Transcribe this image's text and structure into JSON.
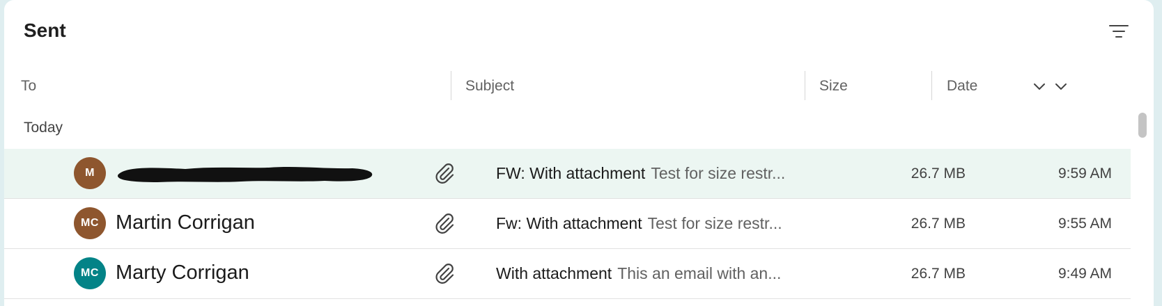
{
  "folder": {
    "title": "Sent"
  },
  "toolbar": {
    "filter_icon": "filter-icon"
  },
  "columns": {
    "to": "To",
    "subject": "Subject",
    "size": "Size",
    "date": "Date"
  },
  "groups": [
    {
      "label": "Today"
    }
  ],
  "messages": [
    {
      "initials": "M",
      "avatar_color": "#8e562e",
      "sender": "",
      "sender_redacted": true,
      "has_attachment": true,
      "subject": "FW: With attachment",
      "preview": "Test for size restr...",
      "size": "26.7 MB",
      "date": "9:59 AM",
      "selected": true
    },
    {
      "initials": "MC",
      "avatar_color": "#8e562e",
      "sender": "Martin Corrigan",
      "has_attachment": true,
      "subject": "Fw: With attachment",
      "preview": "Test for size restr...",
      "size": "26.7 MB",
      "date": "9:55 AM",
      "selected": false
    },
    {
      "initials": "MC",
      "avatar_color": "#038387",
      "sender": "Marty Corrigan",
      "has_attachment": true,
      "subject": "With attachment",
      "preview": "This an email with an...",
      "size": "26.7 MB",
      "date": "9:49 AM",
      "selected": false
    }
  ],
  "colors": {
    "selected_row": "#ecf6f2",
    "background": "#dfeef0"
  }
}
